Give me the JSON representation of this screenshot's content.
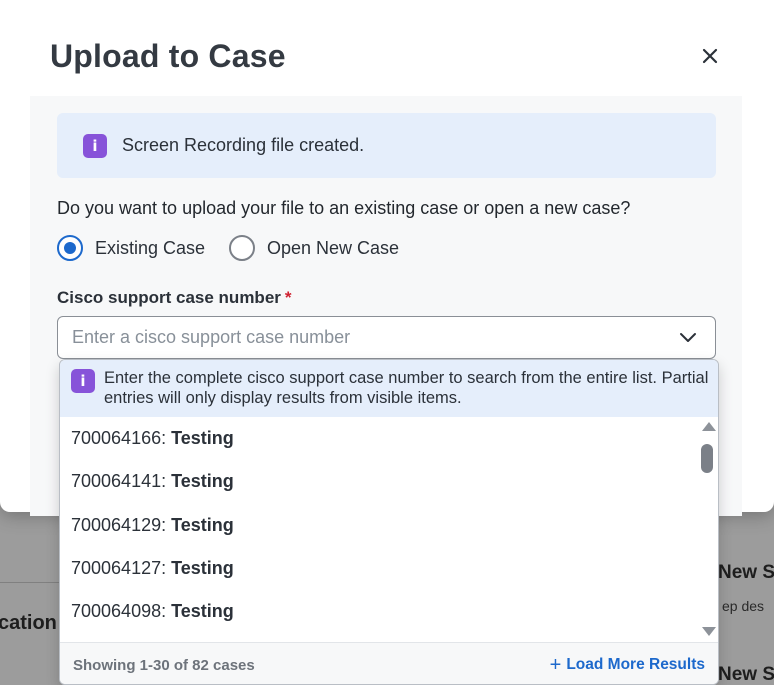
{
  "background": {
    "left_fragment": "cation",
    "right_fragment_1": "New S",
    "right_sub": "ep des",
    "right_fragment_2": "New S"
  },
  "modal": {
    "title": "Upload to Case",
    "close_icon": "close-icon"
  },
  "info_banner": {
    "icon": "info-icon",
    "text": "Screen Recording file created."
  },
  "question": "Do you want to upload your file to an existing case or open a new case?",
  "radio_options": [
    {
      "label": "Existing Case",
      "selected": true
    },
    {
      "label": "Open New Case",
      "selected": false
    }
  ],
  "case_field": {
    "label": "Cisco support case number",
    "required_mark": "*",
    "placeholder": "Enter a cisco support case number",
    "value": ""
  },
  "dropdown": {
    "info_text": "Enter the complete cisco support case number to search from the entire list. Partial entries will only display results from visible items.",
    "items": [
      {
        "number": "700064166",
        "name": "Testing"
      },
      {
        "number": "700064141",
        "name": "Testing"
      },
      {
        "number": "700064129",
        "name": "Testing"
      },
      {
        "number": "700064127",
        "name": "Testing"
      },
      {
        "number": "700064098",
        "name": "Testing"
      }
    ],
    "footer_count": "Showing 1-30 of 82 cases",
    "load_more": "Load More Results"
  },
  "colors": {
    "accent": "#1d69cc",
    "info_bg": "#e5eefb",
    "info_icon": "#8753d9",
    "required": "#cf2030"
  }
}
